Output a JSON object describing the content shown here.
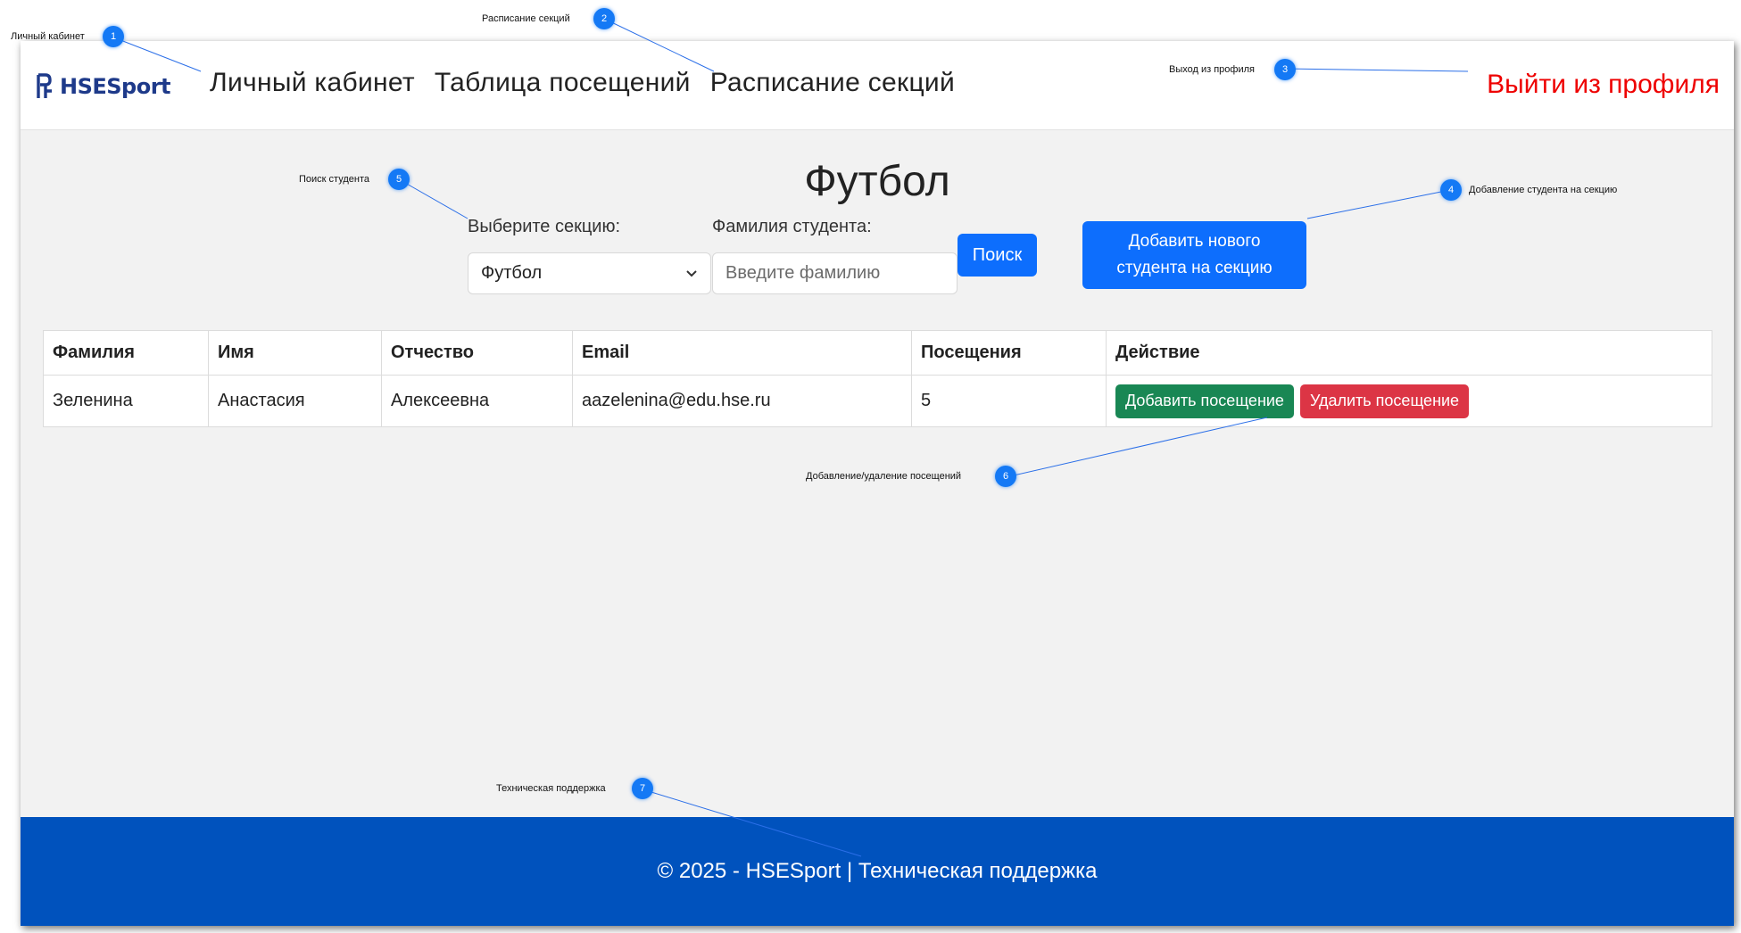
{
  "nav": {
    "logo": "HSESport",
    "links": [
      "Личный кабинет",
      "Таблица посещений",
      "Расписание секций"
    ],
    "logout": "Выйти из профиля"
  },
  "page": {
    "title": "Футбол"
  },
  "form": {
    "section_label": "Выберите секцию:",
    "section_value": "Футбол",
    "surname_label": "Фамилия студента:",
    "surname_placeholder": "Введите фамилию",
    "search_button": "Поиск",
    "add_student_button_line1": "Добавить нового",
    "add_student_button_line2": "студента на секцию"
  },
  "table": {
    "headers": [
      "Фамилия",
      "Имя",
      "Отчество",
      "Email",
      "Посещения",
      "Действие"
    ],
    "rows": [
      {
        "surname": "Зеленина",
        "name": "Анастасия",
        "patronymic": "Алексеевна",
        "email": "aazelenina@edu.hse.ru",
        "visits": "5"
      }
    ],
    "add_visit_button": "Добавить посещение",
    "remove_visit_button": "Удалить посещение"
  },
  "footer": {
    "text": "© 2025 - HSESport | Техническая поддержка"
  },
  "annotations": [
    {
      "num": "1",
      "label": "Личный кабинет"
    },
    {
      "num": "2",
      "label": "Расписание секций"
    },
    {
      "num": "3",
      "label": "Выход из профиля"
    },
    {
      "num": "4",
      "label": "Добавление студента на секцию"
    },
    {
      "num": "5",
      "label": "Поиск студента"
    },
    {
      "num": "6",
      "label": "Добавление/удаление посещений"
    },
    {
      "num": "7",
      "label": "Техническая поддержка"
    }
  ],
  "colors": {
    "primary": "#0d6efd",
    "success": "#198754",
    "danger": "#dc3545",
    "logout": "#ee0000",
    "footer": "#0052bd",
    "annotation": "#1479f5"
  }
}
